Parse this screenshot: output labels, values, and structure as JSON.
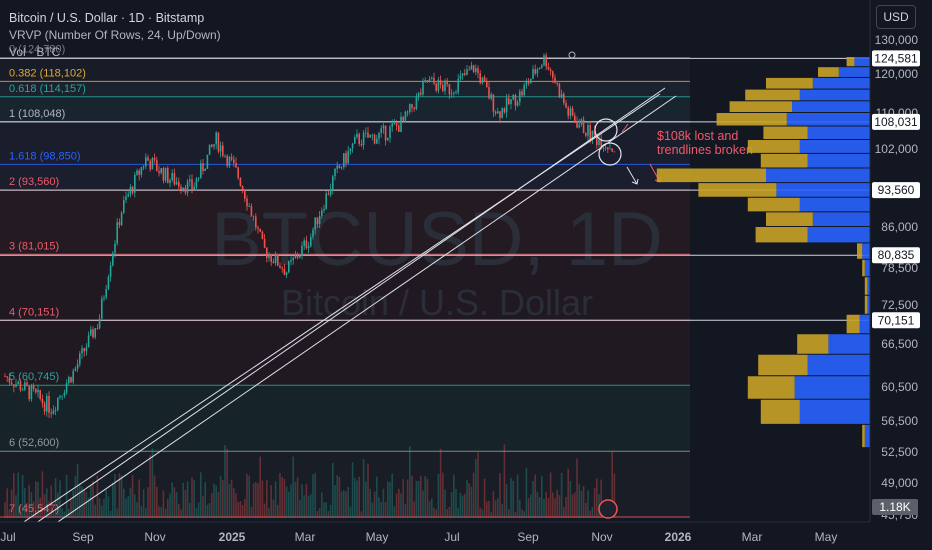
{
  "header": {
    "title": "Bitcoin / U.S. Dollar · 1D · Bitstamp",
    "vrvp": "VRVP (Number Of Rows, 24, Up/Down)",
    "vol": "Vol · BTC"
  },
  "currency_button": "USD",
  "watermark": {
    "symbol": "BTCUSD, 1D",
    "name": "Bitcoin / U.S. Dollar"
  },
  "annotation": {
    "line1": "$108k lost and",
    "line2": "trendlines broken"
  },
  "colors": {
    "background": "#131722",
    "up": "#26a69a",
    "down": "#ef5350",
    "poc_up": "#2962ff",
    "poc_down": "#c9a227",
    "annotation": "#f05a6a"
  },
  "chart_data": {
    "type": "candlestick",
    "title": "Bitcoin / U.S. Dollar · 1D · Bitstamp",
    "x_ticks": [
      "Jul",
      "Sep",
      "Nov",
      "2025",
      "Mar",
      "May",
      "Jul",
      "Sep",
      "Nov",
      "2026",
      "Mar",
      "May"
    ],
    "y_ticks": [
      130000,
      120000,
      110000,
      102000,
      86000,
      78500,
      72500,
      66500,
      60500,
      56500,
      52500,
      49000,
      45750
    ],
    "y_tick_labels": [
      "130,000",
      "120,000",
      "110,000",
      "102,000",
      "86,000",
      "78,500",
      "72,500",
      "66,500",
      "60,500",
      "56,500",
      "52,500",
      "49,000",
      "45,750"
    ],
    "price_badges": [
      {
        "value": 124581,
        "label": "124,581"
      },
      {
        "value": 108031,
        "label": "108,031"
      },
      {
        "value": 93560,
        "label": "93,560"
      },
      {
        "value": 80835,
        "label": "80,835"
      },
      {
        "value": 70151,
        "label": "70,151"
      }
    ],
    "volume_badge": "1.18K",
    "fib_levels": [
      {
        "ratio": "0",
        "value": 124780,
        "label": "0 (124,780)",
        "color": "#787b86"
      },
      {
        "ratio": "0.382",
        "value": 118102,
        "label": "0.382 (118,102)",
        "color": "#e0a83a"
      },
      {
        "ratio": "0.618",
        "value": 114157,
        "label": "0.618 (114,157)",
        "color": "#26a69a"
      },
      {
        "ratio": "1",
        "value": 108048,
        "label": "1 (108,048)",
        "color": "#b2b5be"
      },
      {
        "ratio": "1.618",
        "value": 98850,
        "label": "1.618 (98,850)",
        "color": "#2962ff"
      },
      {
        "ratio": "2",
        "value": 93560,
        "label": "2 (93,560)",
        "color": "#f05a6a"
      },
      {
        "ratio": "3",
        "value": 81015,
        "label": "3 (81,015)",
        "color": "#f05a6a"
      },
      {
        "ratio": "4",
        "value": 70151,
        "label": "4 (70,151)",
        "color": "#f05a6a"
      },
      {
        "ratio": "5",
        "value": 60745,
        "label": "5 (60,745)",
        "color": "#26a69a"
      },
      {
        "ratio": "6",
        "value": 52600,
        "label": "6 (52,600)",
        "color": "#9598a1"
      },
      {
        "ratio": "7",
        "value": 45547,
        "label": "7 (45,547)",
        "color": "#f05a6a"
      }
    ],
    "horizontal_lines": [
      124581,
      108031,
      93560,
      80835,
      70151
    ],
    "trendlines": [
      {
        "from": [
          "Jul",
          45000
        ],
        "to": [
          "Nov",
          114000
        ]
      },
      {
        "from": [
          "Jul",
          46500
        ],
        "to": [
          "Nov",
          116000
        ]
      }
    ],
    "price_path": [
      [
        "Jul",
        62000
      ],
      [
        "Aug",
        60000
      ],
      [
        "Sep",
        58000
      ],
      [
        "Oct",
        63000
      ],
      [
        "Nov",
        70000
      ],
      [
        "Nov",
        90000
      ],
      [
        "Dec",
        100000
      ],
      [
        "Dec",
        96000
      ],
      [
        "2025",
        94000
      ],
      [
        "Jan",
        104000
      ],
      [
        "Feb",
        96000
      ],
      [
        "Mar",
        82000
      ],
      [
        "Apr",
        78000
      ],
      [
        "Apr",
        84000
      ],
      [
        "May",
        96000
      ],
      [
        "May",
        104000
      ],
      [
        "Jun",
        105000
      ],
      [
        "Jul",
        108000
      ],
      [
        "Jul",
        118000
      ],
      [
        "Aug",
        116000
      ],
      [
        "Aug",
        122000
      ],
      [
        "Sep",
        110000
      ],
      [
        "Sep",
        115000
      ],
      [
        "Oct",
        124780
      ],
      [
        "Oct",
        110000
      ],
      [
        "Nov",
        105000
      ],
      [
        "Nov",
        102000
      ]
    ],
    "volume_profile_rows": [
      {
        "price_low": 122000,
        "price_high": 125000,
        "up": 0.06,
        "down": 0.03
      },
      {
        "price_low": 119000,
        "price_high": 122000,
        "up": 0.12,
        "down": 0.08
      },
      {
        "price_low": 116000,
        "price_high": 119000,
        "up": 0.22,
        "down": 0.18
      },
      {
        "price_low": 113000,
        "price_high": 116000,
        "up": 0.27,
        "down": 0.21
      },
      {
        "price_low": 110000,
        "price_high": 113000,
        "up": 0.3,
        "down": 0.24
      },
      {
        "price_low": 107000,
        "price_high": 110000,
        "up": 0.32,
        "down": 0.27
      },
      {
        "price_low": 104000,
        "price_high": 107000,
        "up": 0.24,
        "down": 0.17
      },
      {
        "price_low": 101000,
        "price_high": 104000,
        "up": 0.27,
        "down": 0.2
      },
      {
        "price_low": 98000,
        "price_high": 101000,
        "up": 0.24,
        "down": 0.18
      },
      {
        "price_low": 95000,
        "price_high": 98000,
        "up": 0.4,
        "down": 0.42
      },
      {
        "price_low": 92000,
        "price_high": 95000,
        "up": 0.36,
        "down": 0.3
      },
      {
        "price_low": 89000,
        "price_high": 92000,
        "up": 0.27,
        "down": 0.2
      },
      {
        "price_low": 86000,
        "price_high": 89000,
        "up": 0.22,
        "down": 0.18
      },
      {
        "price_low": 83000,
        "price_high": 86000,
        "up": 0.24,
        "down": 0.2
      },
      {
        "price_low": 80000,
        "price_high": 83000,
        "up": 0.03,
        "down": 0.02
      },
      {
        "price_low": 77000,
        "price_high": 80000,
        "up": 0.02,
        "down": 0.01
      },
      {
        "price_low": 74000,
        "price_high": 77000,
        "up": 0.01,
        "down": 0.01
      },
      {
        "price_low": 71000,
        "price_high": 74000,
        "up": 0.01,
        "down": 0.01
      },
      {
        "price_low": 68000,
        "price_high": 71000,
        "up": 0.04,
        "down": 0.05
      },
      {
        "price_low": 65000,
        "price_high": 68000,
        "up": 0.16,
        "down": 0.12
      },
      {
        "price_low": 62000,
        "price_high": 65000,
        "up": 0.24,
        "down": 0.19
      },
      {
        "price_low": 59000,
        "price_high": 62000,
        "up": 0.29,
        "down": 0.18
      },
      {
        "price_low": 56000,
        "price_high": 59000,
        "up": 0.27,
        "down": 0.15
      },
      {
        "price_low": 53000,
        "price_high": 56000,
        "up": 0.02,
        "down": 0.01
      }
    ]
  }
}
